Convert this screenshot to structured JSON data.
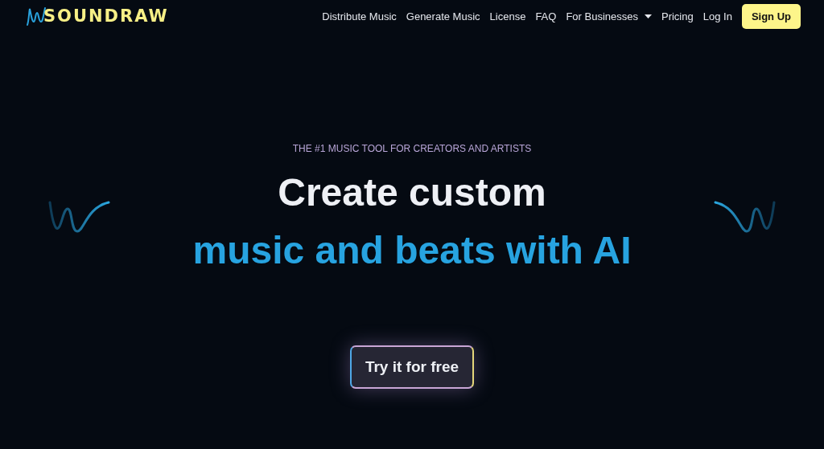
{
  "header": {
    "logo": "SOUNDRAW",
    "nav": [
      {
        "label": "Distribute Music",
        "dropdown": false
      },
      {
        "label": "Generate Music",
        "dropdown": false
      },
      {
        "label": "License",
        "dropdown": false
      },
      {
        "label": "FAQ",
        "dropdown": false
      },
      {
        "label": "For Businesses",
        "dropdown": true
      },
      {
        "label": "Pricing",
        "dropdown": false
      },
      {
        "label": "Log In",
        "dropdown": false
      }
    ],
    "cta": "Sign Up"
  },
  "hero": {
    "tagline": "THE #1 MUSIC TOOL FOR CREATORS AND ARTISTS",
    "headline": "Create custom",
    "headline_accent": "music and beats with AI",
    "button": "Try it for free"
  }
}
